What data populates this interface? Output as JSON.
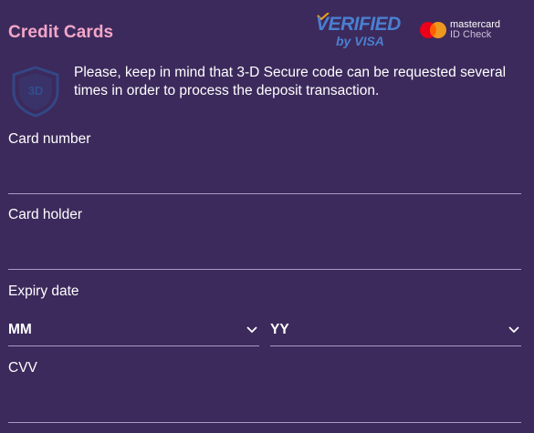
{
  "header": {
    "title": "Credit Cards"
  },
  "badges": {
    "visa_verified": "VERIFIED",
    "visa_by": "by VISA",
    "mastercard_name": "mastercard",
    "mastercard_check": "ID Check"
  },
  "notice": {
    "text": "Please, keep in mind that 3-D Secure code can be requested several times in order to process the deposit transaction."
  },
  "form": {
    "card_number": {
      "label": "Card number",
      "value": ""
    },
    "card_holder": {
      "label": "Card holder",
      "value": ""
    },
    "expiry": {
      "label": "Expiry date",
      "month": "MM",
      "year": "YY"
    },
    "cvv": {
      "label": "CVV",
      "value": ""
    }
  },
  "colors": {
    "background": "#3c2a5c",
    "title": "#f4a6c8",
    "visa_blue": "#4b7fd0",
    "underline": "#a99bc2",
    "mc_red": "#eb001b",
    "mc_orange": "#f79e1b"
  },
  "icons": {
    "shield": "shield-3ds-icon",
    "chevron": "chevron-down-icon"
  }
}
